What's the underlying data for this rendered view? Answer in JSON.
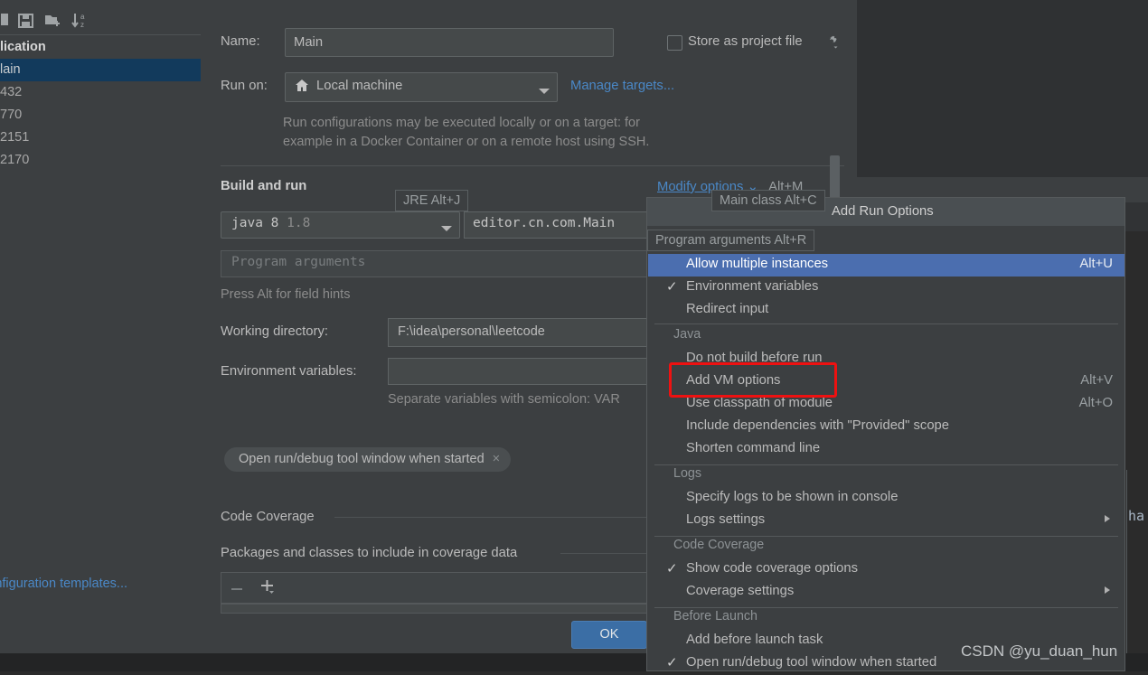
{
  "left_panel": {
    "toolbar_icons": [
      "copy-icon",
      "save-icon",
      "new-folder-icon",
      "sort-alpha-icon"
    ],
    "tree": [
      {
        "label": "lication",
        "type": "group",
        "selected": false
      },
      {
        "label": "lain",
        "type": "item",
        "selected": true
      },
      {
        "label": "432",
        "type": "item",
        "selected": false
      },
      {
        "label": "770",
        "type": "item",
        "selected": false
      },
      {
        "label": "2151",
        "type": "item",
        "selected": false
      },
      {
        "label": "2170",
        "type": "item",
        "selected": false
      }
    ],
    "templates_link": "Edit configuration templates..."
  },
  "dialog": {
    "name_label": "Name:",
    "name_value": "Main",
    "store_as_project_file": "Store as project file",
    "gear_icon": "gear-icon",
    "run_on_label": "Run on:",
    "run_on_value": "Local machine",
    "run_on_icon": "home-icon",
    "manage_targets": "Manage targets...",
    "hint_line1": "Run configurations may be executed locally or on a target: for",
    "hint_line2": "example in a Docker Container or on a remote host using SSH.",
    "build_and_run": "Build and run",
    "jre_value": "java 8",
    "jre_version": "1.8",
    "main_class_value": "editor.cn.com.Main",
    "program_args_placeholder": "Program arguments",
    "press_alt_hint": "Press Alt for field hints",
    "working_dir_label": "Working directory:",
    "working_dir_value": "F:\\idea\\personal\\leetcode",
    "env_vars_label": "Environment variables:",
    "env_vars_value": "",
    "env_vars_hint": "Separate variables with semicolon: VAR",
    "chip_label": "Open run/debug tool window when started",
    "chip_close": "×",
    "code_coverage_title": "Code Coverage",
    "packages_title": "Packages and classes to include in coverage data",
    "minus_icon": "minus-icon",
    "plus_icon": "plus-icon",
    "ok_button": "OK"
  },
  "modify_options": {
    "link_label": "Modify options",
    "link_shortcut": "Alt+M"
  },
  "tooltips": [
    {
      "name": "jre-hint",
      "text": "JRE Alt+J"
    },
    {
      "name": "main-class-hint",
      "text": "Main class Alt+C"
    },
    {
      "name": "program-arguments-hint",
      "text": "Program arguments Alt+R"
    }
  ],
  "menu": {
    "header": "Add Run Options",
    "items": [
      {
        "label": "Allow multiple instances",
        "shortcut": "Alt+U",
        "checked": false,
        "highlighted": true,
        "submenu": false
      },
      {
        "label": "Environment variables",
        "shortcut": "",
        "checked": true,
        "highlighted": false,
        "submenu": false
      },
      {
        "label": "Redirect input",
        "shortcut": "",
        "checked": false,
        "highlighted": false,
        "submenu": false
      }
    ],
    "group_java": "Java",
    "items_java": [
      {
        "label": "Do not build before run",
        "shortcut": "",
        "checked": false,
        "highlighted": false,
        "submenu": false
      },
      {
        "label": "Add VM options",
        "shortcut": "Alt+V",
        "checked": false,
        "highlighted": false,
        "submenu": false
      },
      {
        "label": "Use classpath of module",
        "shortcut": "Alt+O",
        "checked": false,
        "highlighted": false,
        "submenu": false
      },
      {
        "label": "Include dependencies with \"Provided\" scope",
        "shortcut": "",
        "checked": false,
        "highlighted": false,
        "submenu": false
      },
      {
        "label": "Shorten command line",
        "shortcut": "",
        "checked": false,
        "highlighted": false,
        "submenu": false
      }
    ],
    "group_logs": "Logs",
    "items_logs": [
      {
        "label": "Specify logs to be shown in console",
        "shortcut": "",
        "checked": false,
        "highlighted": false,
        "submenu": false
      },
      {
        "label": "Logs settings",
        "shortcut": "",
        "checked": false,
        "highlighted": false,
        "submenu": true
      }
    ],
    "group_coverage": "Code Coverage",
    "items_coverage": [
      {
        "label": "Show code coverage options",
        "shortcut": "",
        "checked": true,
        "highlighted": false,
        "submenu": false
      },
      {
        "label": "Coverage settings",
        "shortcut": "",
        "checked": false,
        "highlighted": false,
        "submenu": true
      }
    ],
    "group_before_launch": "Before Launch",
    "items_before_launch": [
      {
        "label": "Add before launch task",
        "shortcut": "",
        "checked": false,
        "highlighted": false,
        "submenu": false
      },
      {
        "label": "Open run/debug tool window when started",
        "shortcut": "",
        "checked": true,
        "highlighted": false,
        "submenu": false
      }
    ]
  },
  "annotation": {
    "highlight_color": "#ee1111",
    "highlight_target": "Add VM options"
  },
  "background": {
    "code_fragment": "ha"
  },
  "watermark": "CSDN @yu_duan_hun",
  "colors": {
    "accent_blue": "#4b6eaf",
    "link_blue": "#4a88c7",
    "panel_bg": "#3c3f41",
    "editor_bg": "#2b2b2b",
    "selection_blue": "#123a5c"
  }
}
